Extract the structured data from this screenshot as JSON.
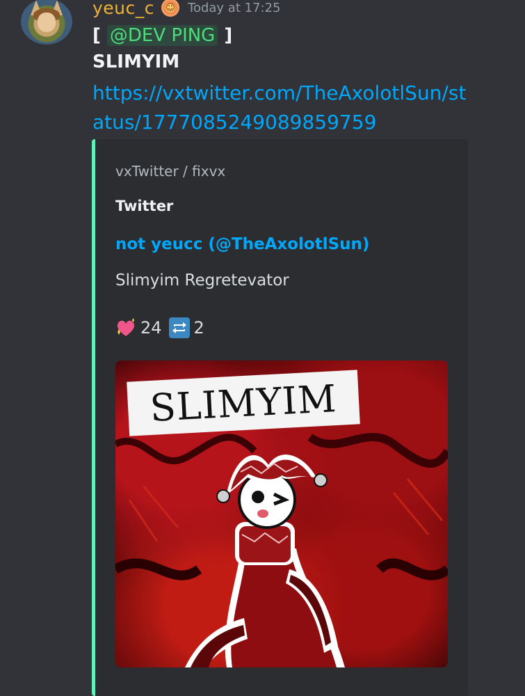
{
  "message": {
    "username": "yeuc_c",
    "timestamp": "Today at 17:25",
    "bracket_open": "[",
    "mention": "@DEV PING",
    "bracket_close": "]",
    "text": "SLIMYIM",
    "link": "https://vxtwitter.com/TheAxolotlSun/status/1777085249089859759"
  },
  "embed": {
    "accent_color": "#5ef2b8",
    "provider": "vxTwitter / fixvx",
    "site": "Twitter",
    "author": "not yeucc (@TheAxolotlSun)",
    "description": "Slimyim Regretevator",
    "likes": "24",
    "retweets": "2",
    "like_icon": "sparkling-heart-icon",
    "retweet_icon": "repeat-icon",
    "image_text": "SLIMYIM"
  },
  "colors": {
    "username": "#f0b232",
    "link": "#00a8fc",
    "mention_text": "#4fdc7c",
    "background": "#313338"
  }
}
